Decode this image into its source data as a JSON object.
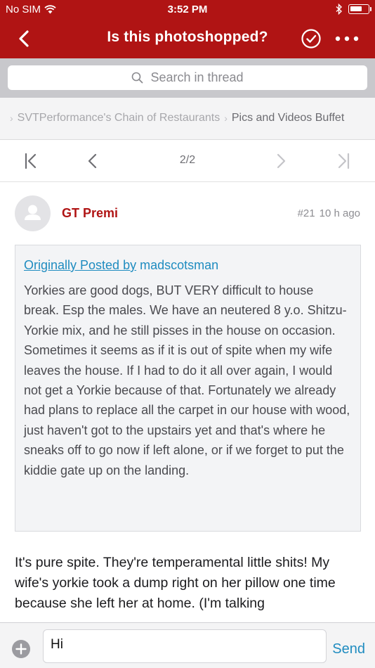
{
  "status_bar": {
    "carrier": "No SIM",
    "time": "3:52 PM"
  },
  "nav": {
    "title": "Is this photoshopped?",
    "back_icon": "chevron-left-icon",
    "check_icon": "check-circle-icon",
    "more_icon": "more-icon"
  },
  "search": {
    "placeholder": "Search in thread"
  },
  "breadcrumb": {
    "items": [
      "SVTPerformance's Chain of Restaurants",
      "Pics and Videos Buffet"
    ]
  },
  "pager": {
    "current": "2/2"
  },
  "post": {
    "author": "GT Premi",
    "number": "#21",
    "time_ago": "10 h ago",
    "quote": {
      "prefix": "Originally Posted by",
      "author": "madscotsman",
      "text": "Yorkies are good dogs, BUT VERY difficult to house break.  Esp the males.  We have an neutered 8 y.o. Shitzu-Yorkie mix, and he still pisses in the house on occasion. Sometimes it seems as if it is out of spite when my wife leaves the house.  If I had to do it all over again, I would not get a Yorkie because of that.  Fortunately we already had plans to replace all the carpet in our house with wood, just haven't got to the upstairs yet and that's where he sneaks off to go now if left alone, or if we forget to put the kiddie gate up on the landing."
    },
    "message": "It's pure spite.  They're temperamental little shits! My wife's yorkie took a dump right on her pillow one time because she left her at home.  (I'm talking"
  },
  "reply": {
    "value": "Hi",
    "send_label": "Send"
  },
  "colors": {
    "brand_red": "#b01414",
    "link_blue": "#1f8cc0"
  }
}
